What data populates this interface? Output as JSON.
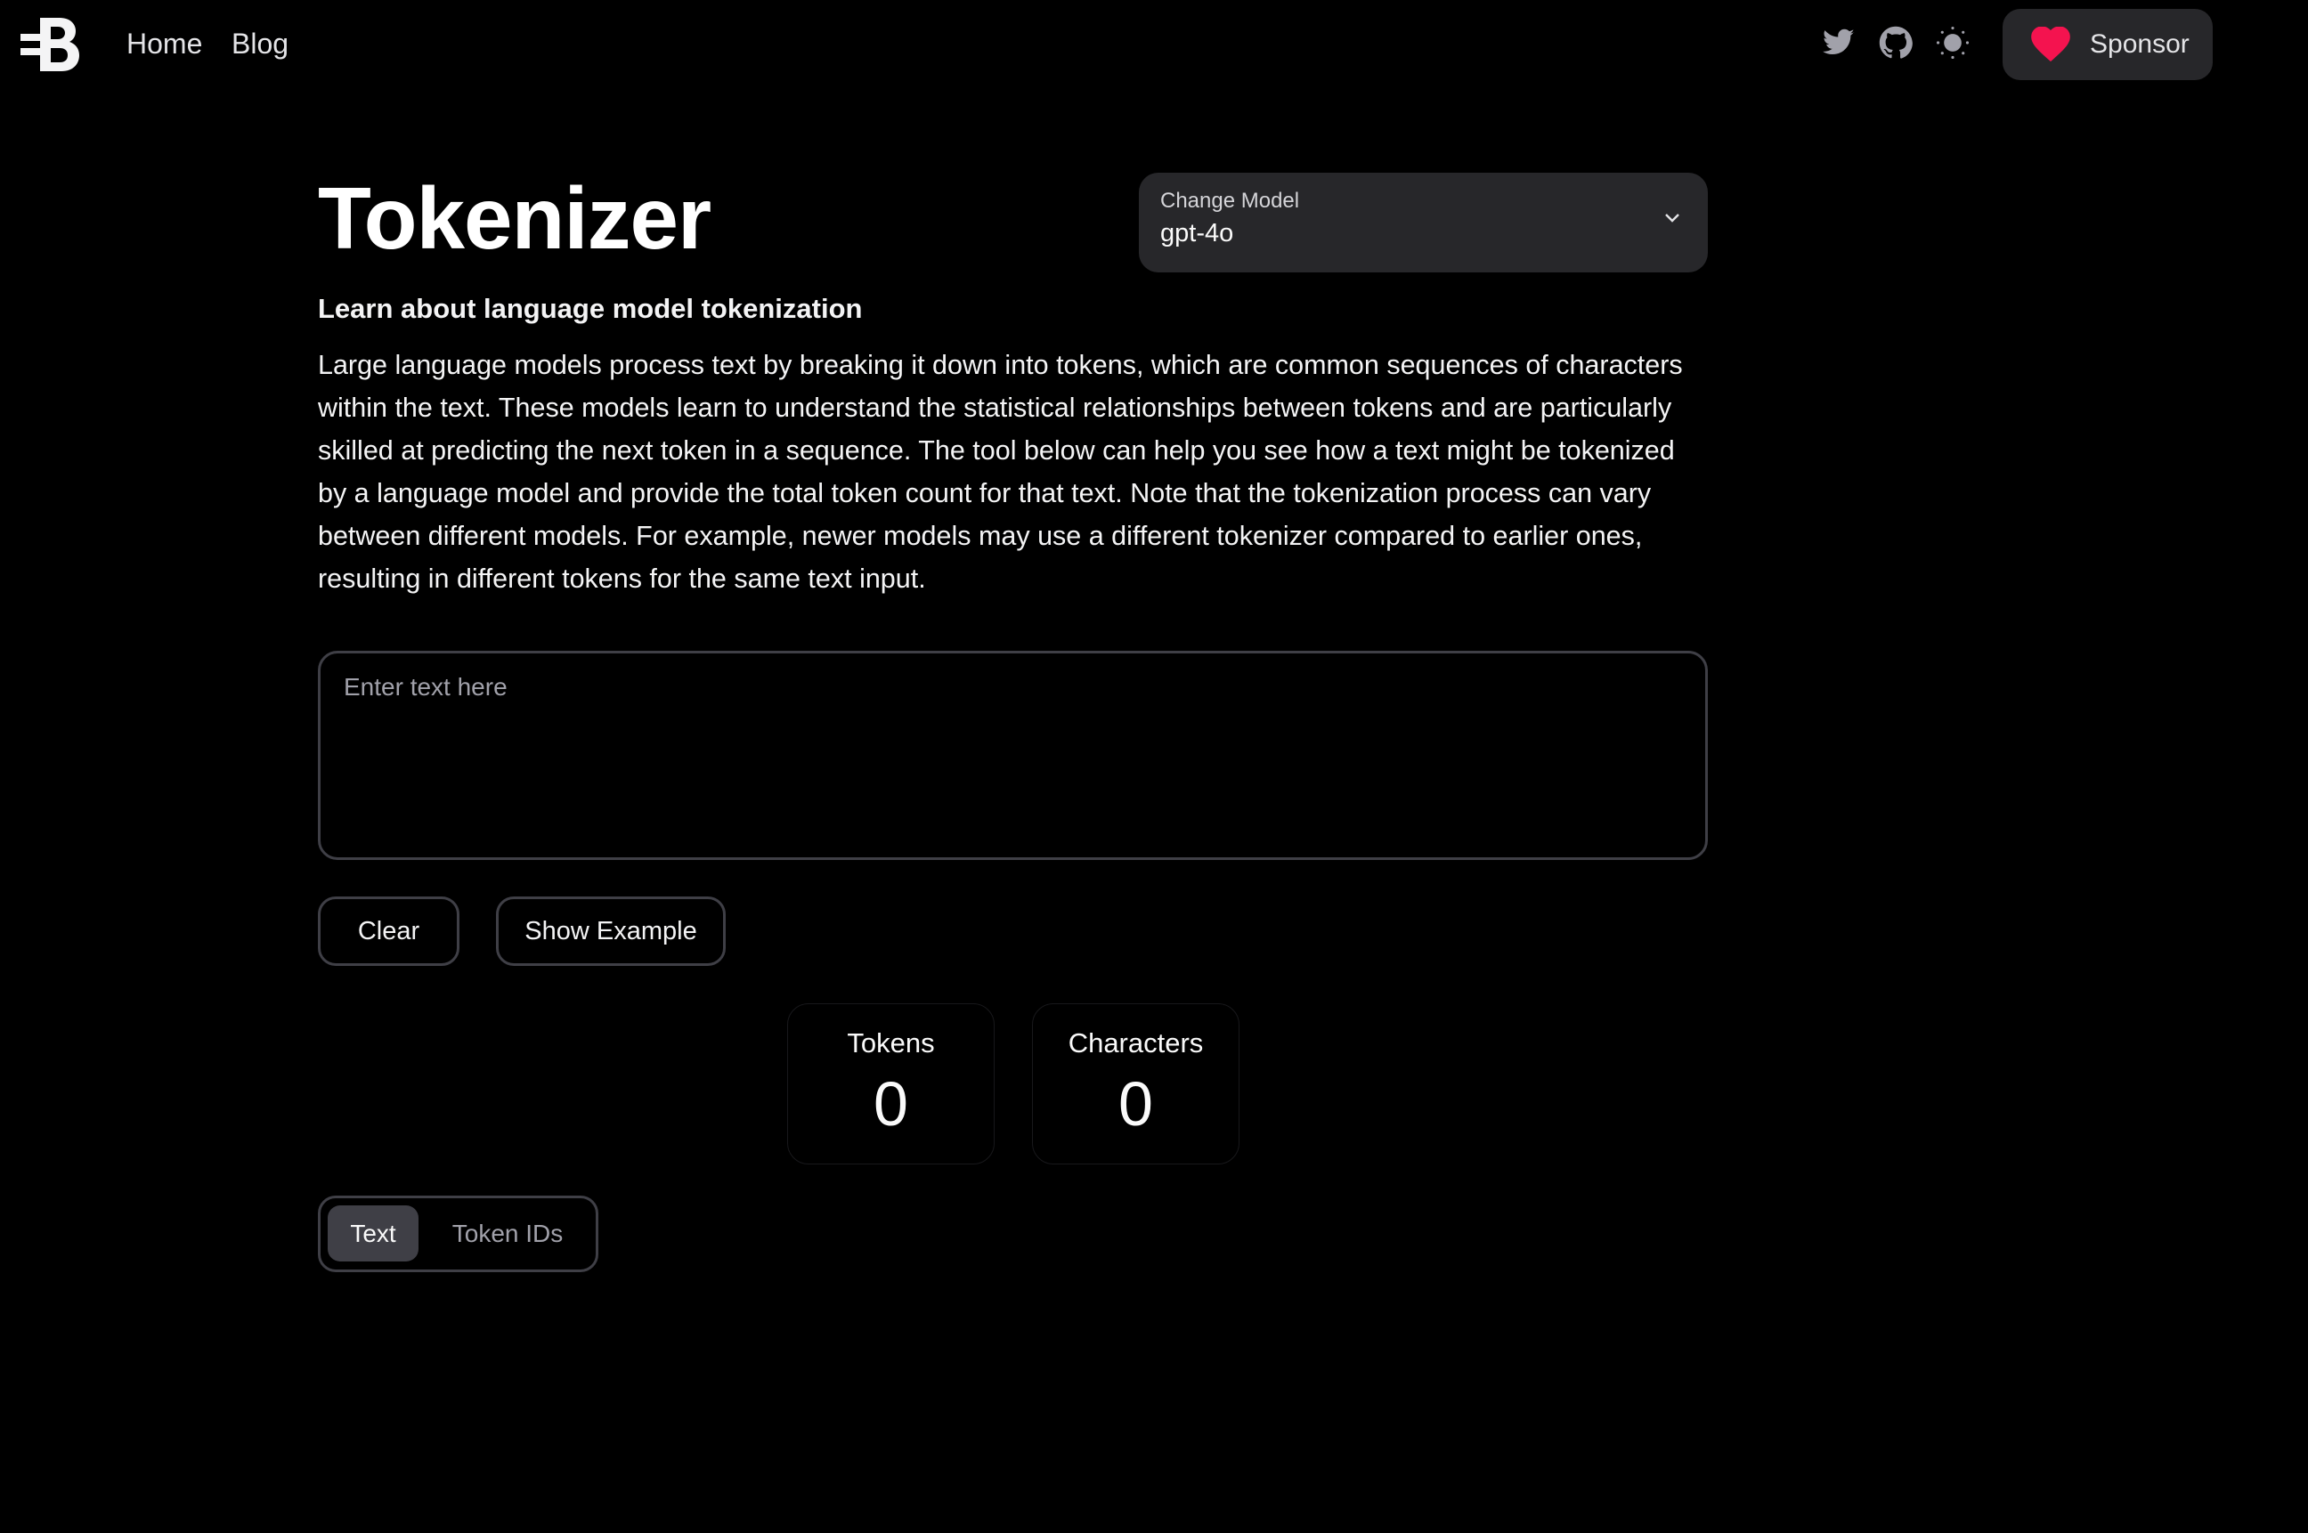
{
  "nav": {
    "logo_name": "B",
    "links": [
      {
        "label": "Home"
      },
      {
        "label": "Blog"
      }
    ],
    "icons": [
      "twitter-icon",
      "github-icon",
      "theme-toggle-sun-icon"
    ],
    "sponsor_label": "Sponsor",
    "sponsor_heart_color": "#f4134f"
  },
  "main": {
    "title": "Tokenizer",
    "subtitle": "Learn about language model tokenization",
    "description": "Large language models process text by breaking it down into tokens, which are common sequences of characters within the text. These models learn to understand the statistical relationships between tokens and are particularly skilled at predicting the next token in a sequence. The tool below can help you see how a text might be tokenized by a language model and provide the total token count for that text. Note that the tokenization process can vary between different models. For example, newer models may use a different tokenizer compared to earlier ones, resulting in different tokens for the same text input.",
    "model_select": {
      "label": "Change Model",
      "value": "gpt-4o"
    },
    "input": {
      "placeholder": "Enter text here",
      "value": ""
    },
    "buttons": {
      "clear": "Clear",
      "show_example": "Show Example"
    },
    "stats": {
      "tokens_label": "Tokens",
      "tokens_value": "0",
      "characters_label": "Characters",
      "characters_value": "0"
    },
    "view_tabs": {
      "active": "Text",
      "items": [
        {
          "label": "Text"
        },
        {
          "label": "Token IDs"
        }
      ]
    }
  },
  "colors": {
    "background": "#000000",
    "surface": "#27272a",
    "border": "#3f3f46",
    "muted_text": "#a1a1aa",
    "accent_heart": "#f4134f"
  }
}
